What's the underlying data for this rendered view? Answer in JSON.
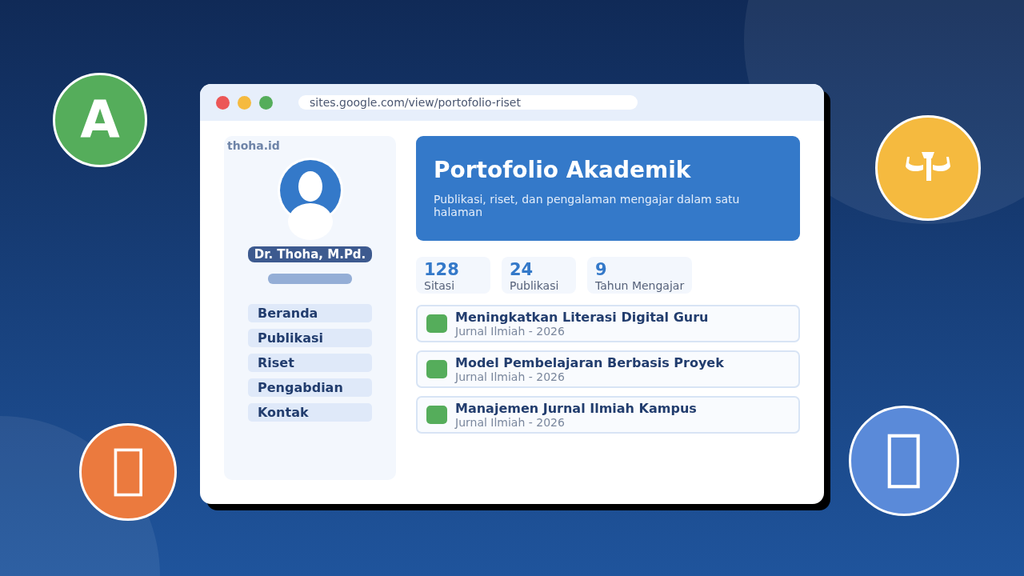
{
  "badges": [
    {
      "kind": "letter",
      "text": "A",
      "color": "#55ad5b"
    },
    {
      "kind": "muscle",
      "color": "#f5ba3f"
    },
    {
      "kind": "glyph-box",
      "color": "#eb7a3e"
    },
    {
      "kind": "glyph-box",
      "color": "#5a8ad9"
    }
  ],
  "browser": {
    "dots": [
      {
        "color": "#ec5757"
      },
      {
        "color": "#f5ba3f"
      },
      {
        "color": "#55ad5b"
      }
    ],
    "url": "sites.google.com/view/portofolio-riset"
  },
  "sidebar": {
    "brand": "thoha.id",
    "name": "Dr. Thoha, M.Pd.",
    "nav": [
      {
        "label": "Beranda"
      },
      {
        "label": "Publikasi"
      },
      {
        "label": "Riset"
      },
      {
        "label": "Pengabdian"
      },
      {
        "label": "Kontak"
      }
    ]
  },
  "hero": {
    "title": "Portofolio Akademik",
    "subtitle": "Publikasi, riset, dan pengalaman mengajar dalam satu halaman"
  },
  "stats": [
    {
      "value": "128",
      "label": "Sitasi"
    },
    {
      "value": "24",
      "label": "Publikasi"
    },
    {
      "value": "9",
      "label": "Tahun Mengajar"
    }
  ],
  "publications": [
    {
      "title": "Meningkatkan Literasi Digital Guru",
      "meta": "Jurnal Ilmiah - 2026",
      "color": "#55ad5b"
    },
    {
      "title": "Model Pembelajaran Berbasis Proyek",
      "meta": "Jurnal Ilmiah - 2026",
      "color": "#55ad5b"
    },
    {
      "title": "Manajemen Jurnal Ilmiah Kampus",
      "meta": "Jurnal Ilmiah - 2026",
      "color": "#55ad5b"
    }
  ]
}
